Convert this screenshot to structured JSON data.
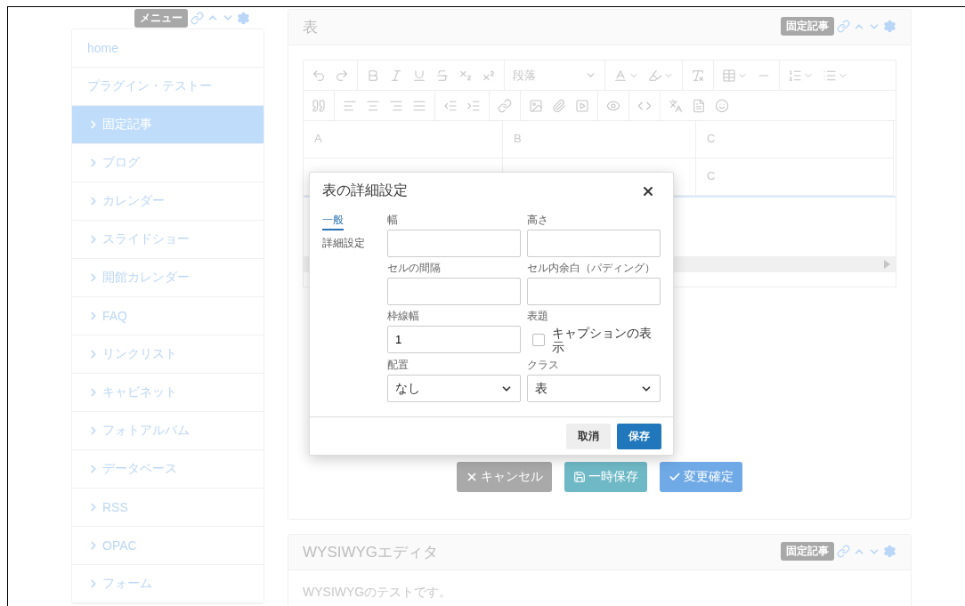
{
  "menu_badge": "メニュー",
  "sidebar": {
    "items": [
      {
        "label": "home",
        "kind": "link",
        "selected": false
      },
      {
        "label": "プラグイン・テストー",
        "kind": "link",
        "selected": false
      },
      {
        "label": "固定記事",
        "kind": "folder",
        "selected": true
      },
      {
        "label": "ブログ",
        "kind": "folder",
        "selected": false
      },
      {
        "label": "カレンダー",
        "kind": "folder",
        "selected": false
      },
      {
        "label": "スライドショー",
        "kind": "folder",
        "selected": false
      },
      {
        "label": "開館カレンダー",
        "kind": "folder",
        "selected": false
      },
      {
        "label": "FAQ",
        "kind": "folder",
        "selected": false
      },
      {
        "label": "リンクリスト",
        "kind": "folder",
        "selected": false
      },
      {
        "label": "キャビネット",
        "kind": "folder",
        "selected": false
      },
      {
        "label": "フォトアルバム",
        "kind": "folder",
        "selected": false
      },
      {
        "label": "データベース",
        "kind": "folder",
        "selected": false
      },
      {
        "label": "RSS",
        "kind": "folder",
        "selected": false
      },
      {
        "label": "OPAC",
        "kind": "folder",
        "selected": false
      },
      {
        "label": "フォーム",
        "kind": "folder",
        "selected": false
      }
    ]
  },
  "table_panel": {
    "title": "表",
    "badge": "固定記事",
    "paragraph_select": "段落",
    "table": {
      "rows": [
        {
          "cells": [
            "A",
            "B",
            "C"
          ]
        },
        {
          "cells": [
            "",
            "",
            "C"
          ]
        }
      ]
    },
    "buttons": [
      {
        "label": "キャンセル",
        "kind": "cancel"
      },
      {
        "label": "一時保存",
        "kind": "draft"
      },
      {
        "label": "変更確定",
        "kind": "confirm"
      }
    ]
  },
  "wysiwyg_panel": {
    "title": "WYSIWYGエディタ",
    "badge": "固定記事",
    "body": "WYSIWYGのテストです。"
  },
  "dialog": {
    "title": "表の詳細設定",
    "tabs": [
      {
        "label": "一般",
        "selected": true
      },
      {
        "label": "詳細設定",
        "selected": false
      }
    ],
    "fields": [
      {
        "label": "幅",
        "kind": "text"
      },
      {
        "label": "高さ",
        "kind": "text"
      },
      {
        "label": "セルの間隔",
        "kind": "text"
      },
      {
        "label": "セル内余白（パディング）",
        "kind": "text"
      },
      {
        "label": "枠線幅",
        "kind": "text",
        "value": "1"
      },
      {
        "label": "表題",
        "kind": "checkbox",
        "option": "キャプションの表示",
        "checked": false
      },
      {
        "label": "配置",
        "kind": "select",
        "value": "なし"
      },
      {
        "label": "クラス",
        "kind": "select",
        "value": "表"
      }
    ],
    "buttons": [
      {
        "label": "取消",
        "kind": "secondary"
      },
      {
        "label": "保存",
        "kind": "primary"
      }
    ]
  }
}
